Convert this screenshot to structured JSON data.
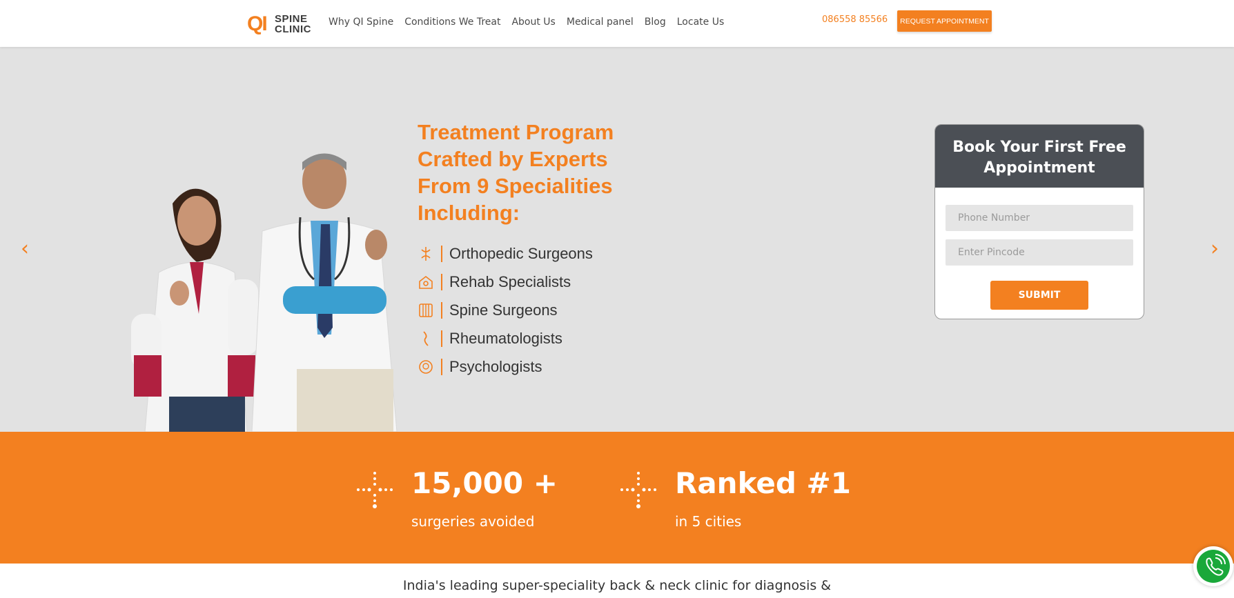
{
  "brand": {
    "logo_mark": "QI",
    "logo_text_line1": "SPINE",
    "logo_text_line2": "CLINIC"
  },
  "nav": {
    "items": [
      "Why QI Spine",
      "Conditions We Treat",
      "About Us",
      "Medical panel",
      "Blog",
      "Locate Us"
    ]
  },
  "header": {
    "phone": "086558 85566",
    "request_button": "REQUEST APPOINTMENT"
  },
  "hero": {
    "headline_lines": [
      "Treatment Program",
      "Crafted by Experts",
      "From 9 Specialities",
      "Including:"
    ],
    "specialities": [
      {
        "label": "Orthopedic Surgeons",
        "icon": "joint-icon"
      },
      {
        "label": "Rehab Specialists",
        "icon": "rehab-icon"
      },
      {
        "label": "Spine Surgeons",
        "icon": "spine-icon"
      },
      {
        "label": "Rheumatologists",
        "icon": "knee-icon"
      },
      {
        "label": "Psychologists",
        "icon": "head-icon"
      }
    ]
  },
  "booking": {
    "title_line1": "Book Your First Free",
    "title_line2": "Appointment",
    "phone_placeholder": "Phone Number",
    "pincode_placeholder": "Enter Pincode",
    "submit": "SUBMIT"
  },
  "stats": [
    {
      "value": "15,000 +",
      "label": "surgeries avoided"
    },
    {
      "value": "Ranked #1",
      "label": "in 5 cities"
    }
  ],
  "tagline": "India's leading super-speciality back & neck clinic for diagnosis &",
  "colors": {
    "accent": "#f38020",
    "hero_bg": "#e2e2e2",
    "form_header": "#4b4f55",
    "call_green": "#1aa83a"
  },
  "icons": {
    "prev": "chevron-left-icon",
    "next": "chevron-right-icon",
    "call": "phone-call-icon",
    "stat": "dots-cross-icon"
  }
}
